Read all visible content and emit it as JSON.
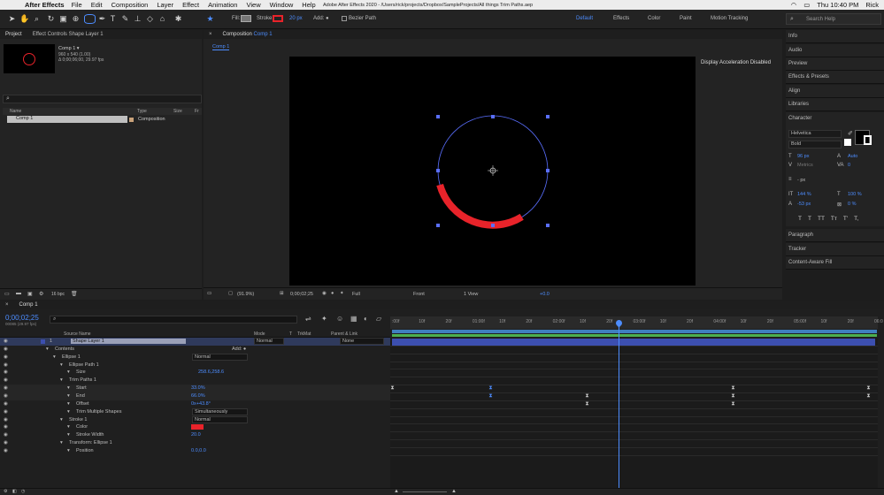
{
  "menubar": {
    "app": "After Effects",
    "items": [
      "File",
      "Edit",
      "Composition",
      "Layer",
      "Effect",
      "Animation",
      "View",
      "Window",
      "Help"
    ],
    "clock": "Thu 10:40 PM",
    "user": "Rick"
  },
  "title": "Adobe After Effects 2020 - /Users/rick/projects/Dropbox/SampleProjects/All things Trim Paths.aep",
  "toolbar": {
    "fill_label": "Fill:",
    "stroke_label": "Stroke:",
    "stroke_width": "20 px",
    "add_label": "Add:",
    "bezier_label": "Bezier Path",
    "workspaces": [
      "Default",
      "Effects",
      "Color",
      "Paint",
      "Motion Tracking"
    ],
    "search_placeholder": "Search Help",
    "accent": "#4d8dff"
  },
  "project": {
    "tab": "Project",
    "effect_controls_tab": "Effect Controls Shape Layer 1",
    "comp_name": "Comp 1 ▾",
    "comp_info1": "960 x 540 (1.00)",
    "comp_info2": "Δ 0;00;06;00, 29.97 fps",
    "col_name": "Name",
    "col_type": "Type",
    "col_size": "Size",
    "col_fr": "Fr",
    "item_name": "Comp 1",
    "item_type": "Composition",
    "bpc": "16 bpc"
  },
  "viewer": {
    "tab_prefix": "Composition",
    "tab_comp": "Comp 1",
    "breadcrumb": "Comp 1",
    "accel_msg": "Display Acceleration Disabled",
    "zoom": "(91.9%)",
    "timecode": "0;00;02;25",
    "resolution": "Full",
    "view": "Front",
    "views": "1 View",
    "exposure": "+0.0"
  },
  "right_panels": [
    "Info",
    "Audio",
    "Preview",
    "Effects & Presets",
    "Align",
    "Libraries"
  ],
  "character": {
    "title": "Character",
    "font": "Helvetica",
    "style": "Bold",
    "size": "96 px",
    "leading": "Auto",
    "kerning_label": "Metrics",
    "tracking": "0",
    "stroke_px": "- px",
    "vscale": "144 %",
    "hscale": "100 %",
    "baseline": "-53 px",
    "tsume": "0 %",
    "type_buttons": [
      "T",
      "T",
      "TT",
      "Tт",
      "T'",
      "T,"
    ]
  },
  "lower_panels": [
    "Paragraph",
    "Tracker",
    "Content-Aware Fill"
  ],
  "timeline": {
    "tab": "Comp 1",
    "timecode": "0;00;02;25",
    "timecode_sub": "00085 (29.97 fps)",
    "search_placeholder": "",
    "col_source": "Source Name",
    "col_mode": "Mode",
    "col_t": "T",
    "col_trkmat": "TrkMat",
    "col_parent": "Parent & Link",
    "ruler": [
      ":00f",
      "10f",
      "20f",
      "01:00f",
      "10f",
      "20f",
      "02:00f",
      "10f",
      "20f",
      "03:00f",
      "10f",
      "20f",
      "04:00f",
      "10f",
      "20f",
      "05:00f",
      "10f",
      "20f",
      "06:0"
    ],
    "rows": [
      {
        "indent": 0,
        "num": "1",
        "label": "Shape Layer 1",
        "mode": "Normal",
        "parent": "None"
      },
      {
        "indent": 1,
        "label": "Contents",
        "extra": "Add: ●"
      },
      {
        "indent": 2,
        "label": "Ellipse 1",
        "mode": "Normal"
      },
      {
        "indent": 3,
        "label": "Ellipse Path 1"
      },
      {
        "indent": 4,
        "label": "Size",
        "value": "258.6,258.6"
      },
      {
        "indent": 3,
        "label": "Trim Paths 1"
      },
      {
        "indent": 4,
        "label": "Start",
        "value": "33.0%"
      },
      {
        "indent": 4,
        "label": "End",
        "value": "66.0%"
      },
      {
        "indent": 4,
        "label": "Offset",
        "value": "0x+43.8°"
      },
      {
        "indent": 4,
        "label": "Trim Multiple Shapes",
        "mode": "Simultaneously"
      },
      {
        "indent": 3,
        "label": "Stroke 1",
        "mode": "Normal"
      },
      {
        "indent": 4,
        "label": "Color"
      },
      {
        "indent": 4,
        "label": "Stroke Width",
        "value": "20.0"
      },
      {
        "indent": 3,
        "label": "Transform: Ellipse 1"
      },
      {
        "indent": 4,
        "label": "Position",
        "value": "0.0,0.0"
      }
    ],
    "stroke_color": "#e8232a",
    "layer_color": "#3c4fb0"
  }
}
